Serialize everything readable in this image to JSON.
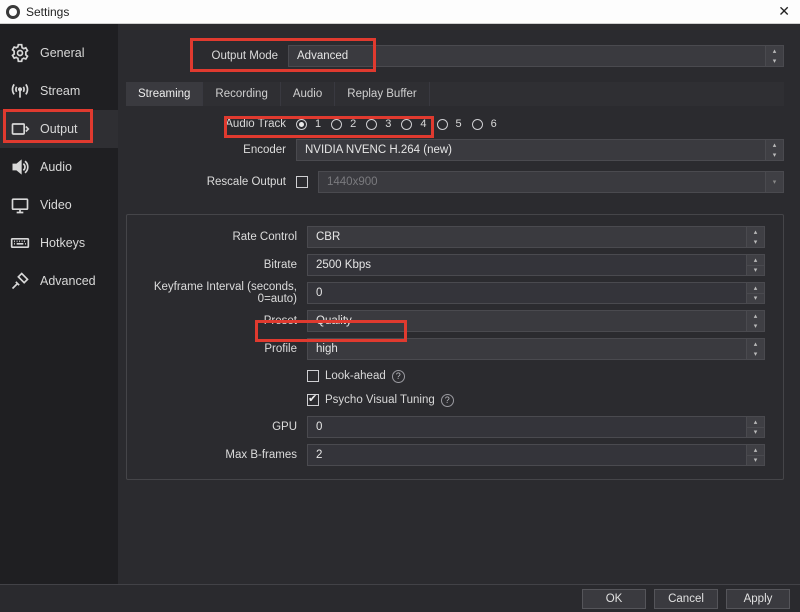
{
  "window": {
    "title": "Settings",
    "close": "✕"
  },
  "sidebar": {
    "items": [
      {
        "id": "general",
        "label": "General"
      },
      {
        "id": "stream",
        "label": "Stream"
      },
      {
        "id": "output",
        "label": "Output"
      },
      {
        "id": "audio",
        "label": "Audio"
      },
      {
        "id": "video",
        "label": "Video"
      },
      {
        "id": "hotkeys",
        "label": "Hotkeys"
      },
      {
        "id": "advanced",
        "label": "Advanced"
      }
    ],
    "active": "output"
  },
  "output_mode": {
    "label": "Output Mode",
    "value": "Advanced"
  },
  "subtabs": {
    "items": [
      {
        "id": "streaming",
        "label": "Streaming"
      },
      {
        "id": "recording",
        "label": "Recording"
      },
      {
        "id": "audio",
        "label": "Audio"
      },
      {
        "id": "replay",
        "label": "Replay Buffer"
      }
    ],
    "active": "streaming"
  },
  "audio_track": {
    "label": "Audio Track",
    "options": [
      "1",
      "2",
      "3",
      "4",
      "5",
      "6"
    ],
    "selected": "1"
  },
  "encoder": {
    "label": "Encoder",
    "value": "NVIDIA NVENC H.264 (new)"
  },
  "rescale": {
    "label": "Rescale Output",
    "checked": false,
    "value": "1440x900"
  },
  "rate_control": {
    "label": "Rate Control",
    "value": "CBR"
  },
  "bitrate": {
    "label": "Bitrate",
    "value": "2500 Kbps"
  },
  "keyframe": {
    "label": "Keyframe Interval (seconds, 0=auto)",
    "value": "0"
  },
  "preset": {
    "label": "Preset",
    "value": "Quality"
  },
  "profile": {
    "label": "Profile",
    "value": "high"
  },
  "look_ahead": {
    "label": "Look-ahead",
    "checked": false
  },
  "psycho": {
    "label": "Psycho Visual Tuning",
    "checked": true
  },
  "gpu": {
    "label": "GPU",
    "value": "0"
  },
  "max_b": {
    "label": "Max B-frames",
    "value": "2"
  },
  "buttons": {
    "ok": "OK",
    "cancel": "Cancel",
    "apply": "Apply"
  }
}
